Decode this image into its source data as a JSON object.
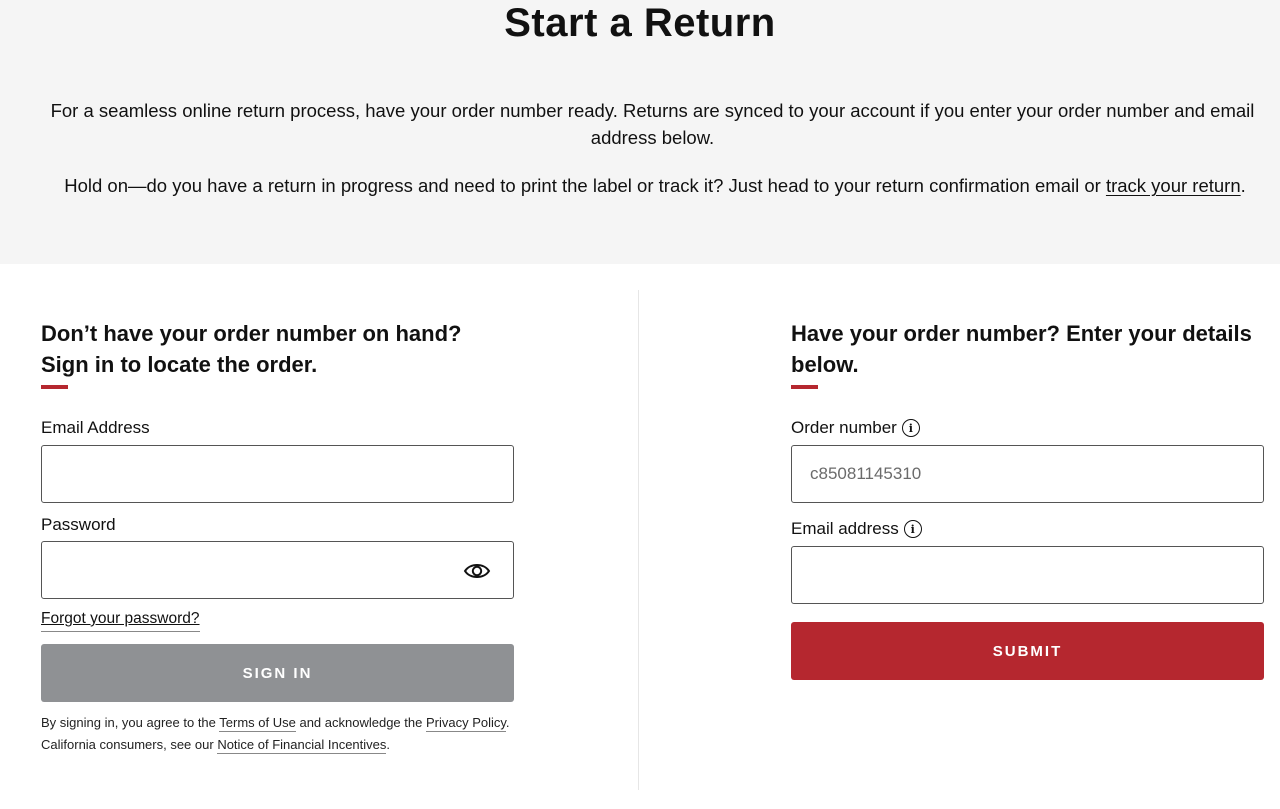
{
  "hero": {
    "title": "Start a Return",
    "intro": "For a seamless online return process, have your order number ready. Returns are synced to your account if you enter your order number and email address below.",
    "progress_prefix": "Hold on—do you have a return in progress and need to print the label or track it? Just head to your return confirmation email or ",
    "track_link": "track your return",
    "progress_suffix": "."
  },
  "signin": {
    "heading_line1": "Don’t have your order number on hand?",
    "heading_line2": "Sign in to locate the order.",
    "email_label": "Email Address",
    "email_value": "",
    "password_label": "Password",
    "password_value": "",
    "forgot_link": "Forgot your password?",
    "button": "SIGN IN",
    "legal": {
      "t1": "By signing in, you agree to the ",
      "terms": "Terms of Use",
      "t2": " and acknowledge the ",
      "privacy": "Privacy Policy",
      "t3": ". California consumers, see our ",
      "notice": "Notice of Financial Incentives",
      "t4": "."
    }
  },
  "order": {
    "heading_line1": "Have your order number? Enter your details",
    "heading_line2": "below.",
    "order_label": "Order number",
    "order_placeholder": "c85081145310",
    "email_label": "Email address",
    "email_value": "",
    "button": "SUBMIT"
  },
  "icons": {
    "info": "info-icon",
    "eye": "eye-icon"
  },
  "colors": {
    "accent": "#b5272f",
    "hero_bg": "#f5f5f5",
    "signin_button": "#8f9194",
    "submit_button": "#b5272f"
  }
}
